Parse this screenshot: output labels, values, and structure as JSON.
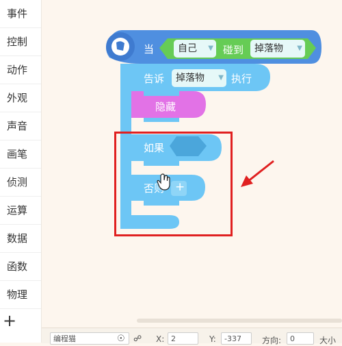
{
  "sidebar": {
    "categories": [
      "事件",
      "控制",
      "动作",
      "外观",
      "声音",
      "画笔",
      "侦测",
      "运算",
      "数据",
      "函数",
      "物理"
    ],
    "add_button": "+"
  },
  "blocks": {
    "when": {
      "label_when": "当",
      "sprite_dropdown": "自己",
      "label_collide": "碰到",
      "target_dropdown": "掉落物"
    },
    "tell": {
      "label_tell": "告诉",
      "target_dropdown": "掉落物",
      "label_execute": "执行"
    },
    "hide": {
      "label": "隐藏"
    },
    "if_else": {
      "label_if": "如果",
      "label_else": "否则",
      "add_button": "+"
    }
  },
  "status_bar": {
    "sprite_name": "编程猫",
    "x_label": "X:",
    "x_value": "2",
    "y_label": "Y:",
    "y_value": "-337",
    "direction_label": "方向:",
    "direction_value": "0",
    "size_label": "大小"
  },
  "colors": {
    "event_green": "#66cc55",
    "control_blue": "#6dc6f5",
    "looks_pink": "#e272e6",
    "highlight_red": "#e02020"
  }
}
